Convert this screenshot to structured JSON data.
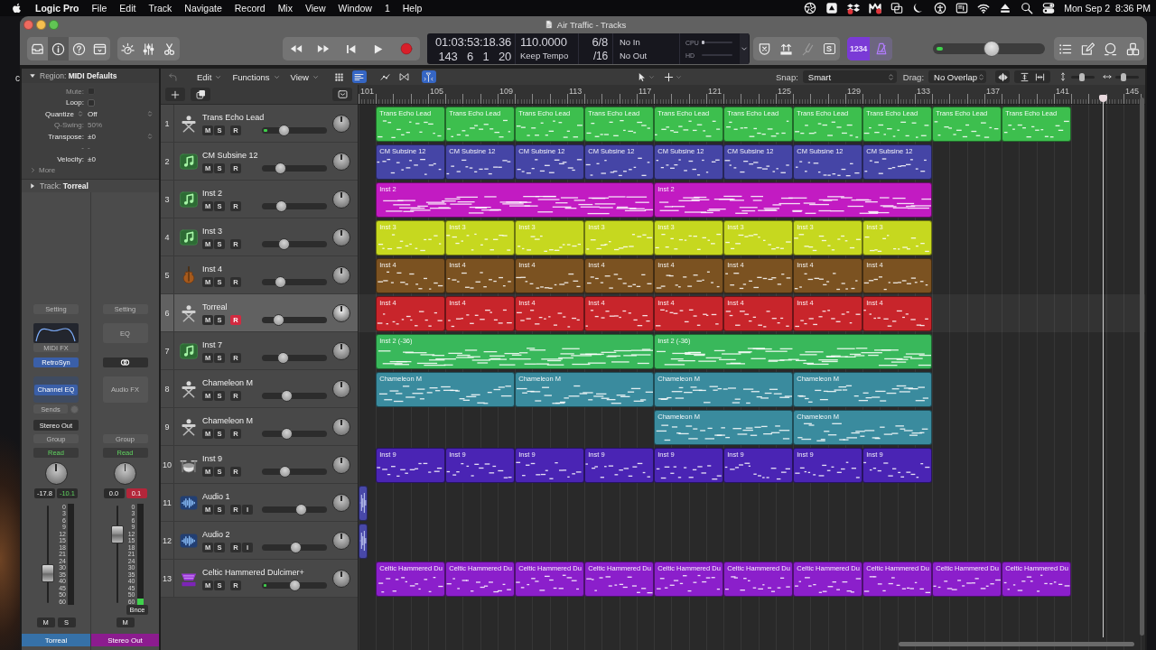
{
  "menu_bar": {
    "app": "Logic Pro",
    "menus": [
      "File",
      "Edit",
      "Track",
      "Navigate",
      "Record",
      "Mix",
      "View",
      "Window",
      "1",
      "Help"
    ],
    "clock": "Mon Sep 2  8:36 PM"
  },
  "desktop": {
    "edge_text": "c"
  },
  "window": {
    "title": "Air Traffic - Tracks"
  },
  "control_bar": {
    "view_buttons": [
      {
        "kind": "library",
        "selected": false
      },
      {
        "kind": "inspector",
        "selected": true
      },
      {
        "kind": "quick_help",
        "selected": false
      },
      {
        "kind": "toolbar",
        "selected": false
      }
    ],
    "window_buttons": [
      {
        "kind": "smart_controls",
        "selected": false
      },
      {
        "kind": "mixer",
        "selected": false
      },
      {
        "kind": "editors",
        "selected": false
      }
    ],
    "lcd": {
      "time": "01:03:53:18.36",
      "position": "143 6 1 20",
      "tempo": "110.0000",
      "tempo_mode": "Keep Tempo",
      "signature": "6/8",
      "division": "/16",
      "input": "No In",
      "output": "No Out",
      "cpu": {
        "label": "CPU",
        "level": 0.1
      },
      "hd": {
        "label": "HD"
      }
    },
    "mode_buttons": [
      {
        "kind": "low_latency",
        "disabled": false
      },
      {
        "kind": "autopunch",
        "disabled": false
      },
      {
        "kind": "tuner",
        "disabled": true
      },
      {
        "kind": "solo",
        "label": "S",
        "disabled": false
      }
    ],
    "count_in": {
      "label": "1234",
      "selected": true
    },
    "metronome": {
      "selected": true
    },
    "master_volume": {
      "level": 0.53
    },
    "master_meter": {
      "level": 0.06
    }
  },
  "inspector": {
    "region": {
      "title": "Region: **MIDI Defaults**",
      "expanded": true
    },
    "params": [
      {
        "kind": "checkbox",
        "label": "Mute:",
        "checked": false,
        "disabled": true
      },
      {
        "kind": "checkbox",
        "label": "Loop:",
        "checked": false,
        "disabled": false
      },
      {
        "kind": "selector",
        "label": "Quantize",
        "value": "Off",
        "disabled": false
      },
      {
        "kind": "value",
        "label": "Q-Swing:",
        "value": "50%",
        "disabled": true
      },
      {
        "kind": "menu",
        "label": "Transpose:",
        "value": "±0",
        "disabled": false
      },
      {
        "kind": "value",
        "label": "-",
        "value": "-",
        "disabled": true
      },
      {
        "kind": "value",
        "label": "Velocity:",
        "value": "±0",
        "disabled": false
      }
    ],
    "more": {
      "label": "More",
      "expanded": false
    },
    "track": {
      "title": "Track: **Torreal**",
      "expanded": false
    },
    "channel_strips": [
      {
        "setting": "Setting",
        "eq": {
          "kind": "curve"
        },
        "midi_fx": "MIDI FX",
        "insert": {
          "kind": "plugin",
          "label": "RetroSyn"
        },
        "audio_fx": {
          "kind": "plugin",
          "label": "Channel EQ"
        },
        "sends": "Sends",
        "output": "Stereo Out",
        "group": "Group",
        "automation": "Read",
        "volume": "-17.8",
        "peak": "-10.1",
        "clipped": false,
        "fader": {
          "level": 0.27
        },
        "scale": [
          "0",
          "3",
          "6",
          "9",
          "12",
          "15",
          "18",
          "21",
          "24",
          "30",
          "35",
          "40",
          "45",
          "50",
          "60"
        ],
        "buttons": [
          "M",
          "S"
        ],
        "name": "Torreal",
        "color": "#3671a8"
      },
      {
        "setting": "Setting",
        "eq": {
          "kind": "empty",
          "label": "EQ"
        },
        "insert": {
          "kind": "link"
        },
        "audio_fx": {
          "kind": "empty",
          "label": "Audio FX"
        },
        "group": "Group",
        "automation": "Read",
        "volume": "0.0",
        "peak": "0.1",
        "clipped": true,
        "fader": {
          "level": 0.74
        },
        "meter": {
          "level": 0.06
        },
        "scale": [
          "0",
          "3",
          "6",
          "9",
          "12",
          "15",
          "18",
          "21",
          "24",
          "30",
          "35",
          "40",
          "45",
          "50",
          "60"
        ],
        "bounce": "Bnce",
        "buttons": [
          "M"
        ],
        "name": "Stereo Out",
        "color": "#8c1c8f"
      }
    ]
  },
  "tracks_area": {
    "menus": [
      "Edit",
      "Functions",
      "View"
    ],
    "view_toggles": [
      {
        "kind": "grid",
        "selected": false
      },
      {
        "kind": "lanes",
        "selected": true
      },
      {
        "kind": "automation",
        "selected": false
      },
      {
        "kind": "flex",
        "selected": false
      },
      {
        "kind": "catch",
        "selected": true
      }
    ],
    "snap": {
      "label": "Snap:",
      "value": "Smart"
    },
    "drag": {
      "label": "Drag:",
      "value": "No Overlap"
    },
    "zoom_sliders": [
      {
        "kind": "vertical",
        "level": 0.45
      },
      {
        "kind": "horizontal",
        "level": 0.3
      }
    ],
    "ruler": [
      "101",
      "105",
      "109",
      "113",
      "117",
      "121",
      "125",
      "129",
      "133",
      "137",
      "141",
      "145"
    ],
    "tracks": [
      {
        "number": "1",
        "name": "Trans Echo Lead",
        "kind": "keyboard",
        "color": "#3dbf4e",
        "selected": false,
        "buttons": [
          "M",
          "S",
          "R"
        ],
        "record_armed": false,
        "volume": {
          "level": 0.3
        },
        "meter": {
          "level": 0.06
        },
        "lane": [
          {
            "name": "Trans Echo Lead",
            "kind": "short"
          },
          {
            "name": "Trans Echo Lead",
            "kind": "short"
          },
          {
            "name": "Trans Echo Lead",
            "kind": "short"
          },
          {
            "name": "Trans Echo Lead",
            "kind": "short"
          },
          {
            "name": "Trans Echo Lead",
            "kind": "short"
          },
          {
            "name": "Trans Echo Lead",
            "kind": "short"
          },
          {
            "name": "Trans Echo Lead",
            "kind": "short"
          },
          {
            "name": "Trans Echo Lead",
            "kind": "short"
          },
          {
            "name": "Trans Echo Lead",
            "kind": "short"
          },
          {
            "name": "Trans Echo Lead",
            "kind": "short"
          }
        ]
      },
      {
        "number": "2",
        "name": "CM Subsine 12",
        "kind": "note",
        "color": "#4545a6",
        "selected": false,
        "buttons": [
          "M",
          "S",
          "R"
        ],
        "record_armed": false,
        "volume": {
          "level": 0.23
        },
        "lane": [
          {
            "name": "CM Subsine 12",
            "kind": "short"
          },
          {
            "name": "CM Subsine 12",
            "kind": "short"
          },
          {
            "name": "CM Subsine 12",
            "kind": "short"
          },
          {
            "name": "CM Subsine 12",
            "kind": "short"
          },
          {
            "name": "CM Subsine 12",
            "kind": "short"
          },
          {
            "name": "CM Subsine 12",
            "kind": "short"
          },
          {
            "name": "CM Subsine 12",
            "kind": "short"
          },
          {
            "name": "CM Subsine 12",
            "kind": "short"
          }
        ]
      },
      {
        "number": "3",
        "name": "Inst 2",
        "kind": "note",
        "color": "#c21bc2",
        "selected": false,
        "buttons": [
          "M",
          "S",
          "R"
        ],
        "record_armed": false,
        "volume": {
          "level": 0.25
        },
        "lane": [
          {
            "name": "Inst 2",
            "kind": "long"
          },
          {
            "name": "Inst 2",
            "kind": "long"
          }
        ]
      },
      {
        "number": "4",
        "name": "Inst 3",
        "kind": "note",
        "color": "#c6d81f",
        "selected": false,
        "buttons": [
          "M",
          "S",
          "R"
        ],
        "record_armed": false,
        "volume": {
          "level": 0.3
        },
        "lane": [
          {
            "name": "Inst 3",
            "kind": "short"
          },
          {
            "name": "Inst 3",
            "kind": "short"
          },
          {
            "name": "Inst 3",
            "kind": "short"
          },
          {
            "name": "Inst 3",
            "kind": "short"
          },
          {
            "name": "Inst 3",
            "kind": "short"
          },
          {
            "name": "Inst 3",
            "kind": "short"
          },
          {
            "name": "Inst 3",
            "kind": "short"
          },
          {
            "name": "Inst 3",
            "kind": "short"
          }
        ]
      },
      {
        "number": "5",
        "name": "Inst 4",
        "kind": "violin",
        "color": "#7b5221",
        "selected": false,
        "buttons": [
          "M",
          "S",
          "R"
        ],
        "record_armed": false,
        "volume": {
          "level": 0.23
        },
        "lane": [
          {
            "name": "Inst 4",
            "kind": "short"
          },
          {
            "name": "Inst 4",
            "kind": "short"
          },
          {
            "name": "Inst 4",
            "kind": "short"
          },
          {
            "name": "Inst 4",
            "kind": "short"
          },
          {
            "name": "Inst 4",
            "kind": "short"
          },
          {
            "name": "Inst 4",
            "kind": "short"
          },
          {
            "name": "Inst 4",
            "kind": "short"
          },
          {
            "name": "Inst 4",
            "kind": "short"
          }
        ]
      },
      {
        "number": "6",
        "name": "Torreal",
        "kind": "keyboard",
        "color": "#c8252b",
        "selected": true,
        "buttons": [
          "M",
          "S",
          "R"
        ],
        "record_armed": true,
        "volume": {
          "level": 0.2
        },
        "lane": [
          {
            "name": "Inst 4",
            "kind": "short"
          },
          {
            "name": "Inst 4",
            "kind": "short"
          },
          {
            "name": "Inst 4",
            "kind": "short"
          },
          {
            "name": "Inst 4",
            "kind": "short"
          },
          {
            "name": "Inst 4",
            "kind": "short"
          },
          {
            "name": "Inst 4",
            "kind": "short"
          },
          {
            "name": "Inst 4",
            "kind": "short"
          },
          {
            "name": "Inst 4",
            "kind": "short"
          }
        ]
      },
      {
        "number": "7",
        "name": "Inst 7",
        "kind": "note",
        "color": "#39b85b",
        "selected": false,
        "buttons": [
          "M",
          "S",
          "R"
        ],
        "record_armed": false,
        "volume": {
          "level": 0.28
        },
        "lane": [
          {
            "name": "Inst 2 (-36)",
            "kind": "long"
          },
          {
            "name": "Inst 2 (-36)",
            "kind": "long"
          }
        ]
      },
      {
        "number": "8",
        "name": "Chameleon M",
        "kind": "keyboard",
        "color": "#3a8b9e",
        "selected": false,
        "buttons": [
          "M",
          "S",
          "R"
        ],
        "record_armed": false,
        "volume": {
          "level": 0.35
        },
        "lane": [
          {
            "name": "Chameleon M",
            "kind": "double"
          },
          {
            "name": "Chameleon M",
            "kind": "double"
          },
          {
            "name": "Chameleon M",
            "kind": "double"
          },
          {
            "name": "Chameleon M",
            "kind": "double"
          }
        ]
      },
      {
        "number": "9",
        "name": "Chameleon M",
        "kind": "keyboard",
        "color": "#3a8b9e",
        "selected": false,
        "buttons": [
          "M",
          "S",
          "R"
        ],
        "record_armed": false,
        "volume": {
          "level": 0.35
        },
        "lane": [
          {
            "kind": "gap"
          },
          {
            "kind": "gap"
          },
          {
            "kind": "gap"
          },
          {
            "kind": "gap"
          },
          {
            "name": "Chameleon M",
            "kind": "double"
          },
          {
            "name": "Chameleon M",
            "kind": "double"
          }
        ]
      },
      {
        "number": "10",
        "name": "Inst 9",
        "kind": "drums",
        "color": "#4a24b4",
        "selected": false,
        "buttons": [
          "M",
          "S",
          "R"
        ],
        "record_armed": false,
        "volume": {
          "level": 0.33
        },
        "lane": [
          {
            "name": "Inst 9",
            "kind": "short"
          },
          {
            "name": "Inst 9",
            "kind": "short"
          },
          {
            "name": "Inst 9",
            "kind": "short"
          },
          {
            "name": "Inst 9",
            "kind": "short"
          },
          {
            "name": "Inst 9",
            "kind": "short"
          },
          {
            "name": "Inst 9",
            "kind": "short"
          },
          {
            "name": "Inst 9",
            "kind": "short"
          },
          {
            "name": "Inst 9",
            "kind": "short"
          }
        ]
      },
      {
        "number": "11",
        "name": "Audio 1",
        "kind": "audio",
        "color": "#4848a8",
        "selected": false,
        "buttons": [
          "M",
          "S",
          "R",
          "I"
        ],
        "record_armed": false,
        "volume": {
          "level": 0.63
        },
        "lane": [
          {
            "kind": "tail"
          }
        ]
      },
      {
        "number": "12",
        "name": "Audio 2",
        "kind": "audio",
        "color": "#4848a8",
        "selected": false,
        "buttons": [
          "M",
          "S",
          "R",
          "I"
        ],
        "record_armed": false,
        "volume": {
          "level": 0.53
        },
        "lane": [
          {
            "kind": "tail"
          }
        ]
      },
      {
        "number": "13",
        "name": "Celtic Hammered Dulcimer+",
        "kind": "dulcimer",
        "color": "#8b1fcb",
        "selected": false,
        "buttons": [
          "M",
          "S",
          "R"
        ],
        "record_armed": false,
        "volume": {
          "level": 0.5
        },
        "meter": {
          "level": 0.04
        },
        "lane": [
          {
            "name": "Celtic Hammered Du",
            "kind": "short"
          },
          {
            "name": "Celtic Hammered Du",
            "kind": "short"
          },
          {
            "name": "Celtic Hammered Du",
            "kind": "short"
          },
          {
            "name": "Celtic Hammered Du",
            "kind": "short"
          },
          {
            "name": "Celtic Hammered Du",
            "kind": "short"
          },
          {
            "name": "Celtic Hammered Du",
            "kind": "short"
          },
          {
            "name": "Celtic Hammered Du",
            "kind": "short"
          },
          {
            "name": "Celtic Hammered Du",
            "kind": "short"
          },
          {
            "name": "Celtic Hammered Du",
            "kind": "short"
          },
          {
            "name": "Celtic Hammered Du",
            "kind": "short"
          }
        ]
      }
    ]
  }
}
